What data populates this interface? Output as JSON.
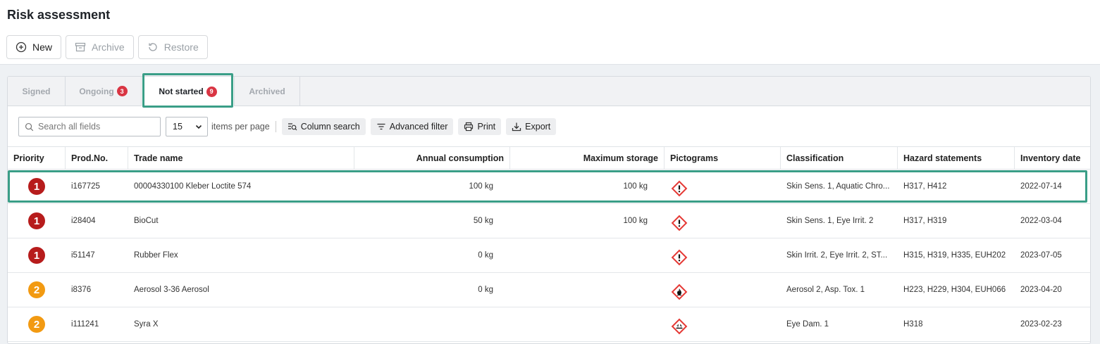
{
  "page": {
    "title": "Risk assessment"
  },
  "toolbar": {
    "new_label": "New",
    "archive_label": "Archive",
    "restore_label": "Restore"
  },
  "tabs": [
    {
      "label": "Signed",
      "badge": null
    },
    {
      "label": "Ongoing",
      "badge": "3"
    },
    {
      "label": "Not started",
      "badge": "9",
      "active": true
    },
    {
      "label": "Archived",
      "badge": null
    }
  ],
  "filter": {
    "search_placeholder": "Search all fields",
    "per_page_value": "15",
    "per_page_label": "items per page",
    "column_search_label": "Column search",
    "advanced_filter_label": "Advanced filter",
    "print_label": "Print",
    "export_label": "Export"
  },
  "table": {
    "headers": {
      "priority": "Priority",
      "prod_no": "Prod.No.",
      "trade_name": "Trade name",
      "annual_consumption": "Annual consumption",
      "maximum_storage": "Maximum storage",
      "pictograms": "Pictograms",
      "classification": "Classification",
      "hazard_statements": "Hazard statements",
      "inventory_date": "Inventory date"
    },
    "rows": [
      {
        "priority": "1",
        "prod_no": "i167725",
        "trade_name": "00004330100 Kleber Loctite 574",
        "annual_consumption": "100 kg",
        "maximum_storage": "100 kg",
        "pictogram": "exclamation-icon",
        "classification": "Skin Sens. 1, Aquatic Chro...",
        "hazard_statements": "H317, H412",
        "inventory_date": "2022-07-14"
      },
      {
        "priority": "1",
        "prod_no": "i28404",
        "trade_name": "BioCut",
        "annual_consumption": "50 kg",
        "maximum_storage": "100 kg",
        "pictogram": "exclamation-icon",
        "classification": "Skin Sens. 1, Eye Irrit. 2",
        "hazard_statements": "H317, H319",
        "inventory_date": "2022-03-04"
      },
      {
        "priority": "1",
        "prod_no": "i51147",
        "trade_name": "Rubber Flex",
        "annual_consumption": "0 kg",
        "maximum_storage": "",
        "pictogram": "exclamation-icon",
        "classification": "Skin Irrit. 2, Eye Irrit. 2, ST...",
        "hazard_statements": "H315, H319, H335, EUH202",
        "inventory_date": "2023-07-05"
      },
      {
        "priority": "2",
        "prod_no": "i8376",
        "trade_name": "Aerosol 3-36 Aerosol",
        "annual_consumption": "0 kg",
        "maximum_storage": "",
        "pictogram": "flame-icon",
        "classification": "Aerosol 2, Asp. Tox. 1",
        "hazard_statements": "H223, H229, H304, EUH066",
        "inventory_date": "2023-04-20"
      },
      {
        "priority": "2",
        "prod_no": "i111241",
        "trade_name": "Syra X",
        "annual_consumption": "",
        "maximum_storage": "",
        "pictogram": "corrosion-icon",
        "classification": "Eye Dam. 1",
        "hazard_statements": "H318",
        "inventory_date": "2023-02-23"
      }
    ]
  },
  "colors": {
    "priority_1": "#b71c1c",
    "priority_2": "#f29a12",
    "highlight": "#3a9e87",
    "badge": "#d93543",
    "pictogram_border": "#e53935"
  }
}
